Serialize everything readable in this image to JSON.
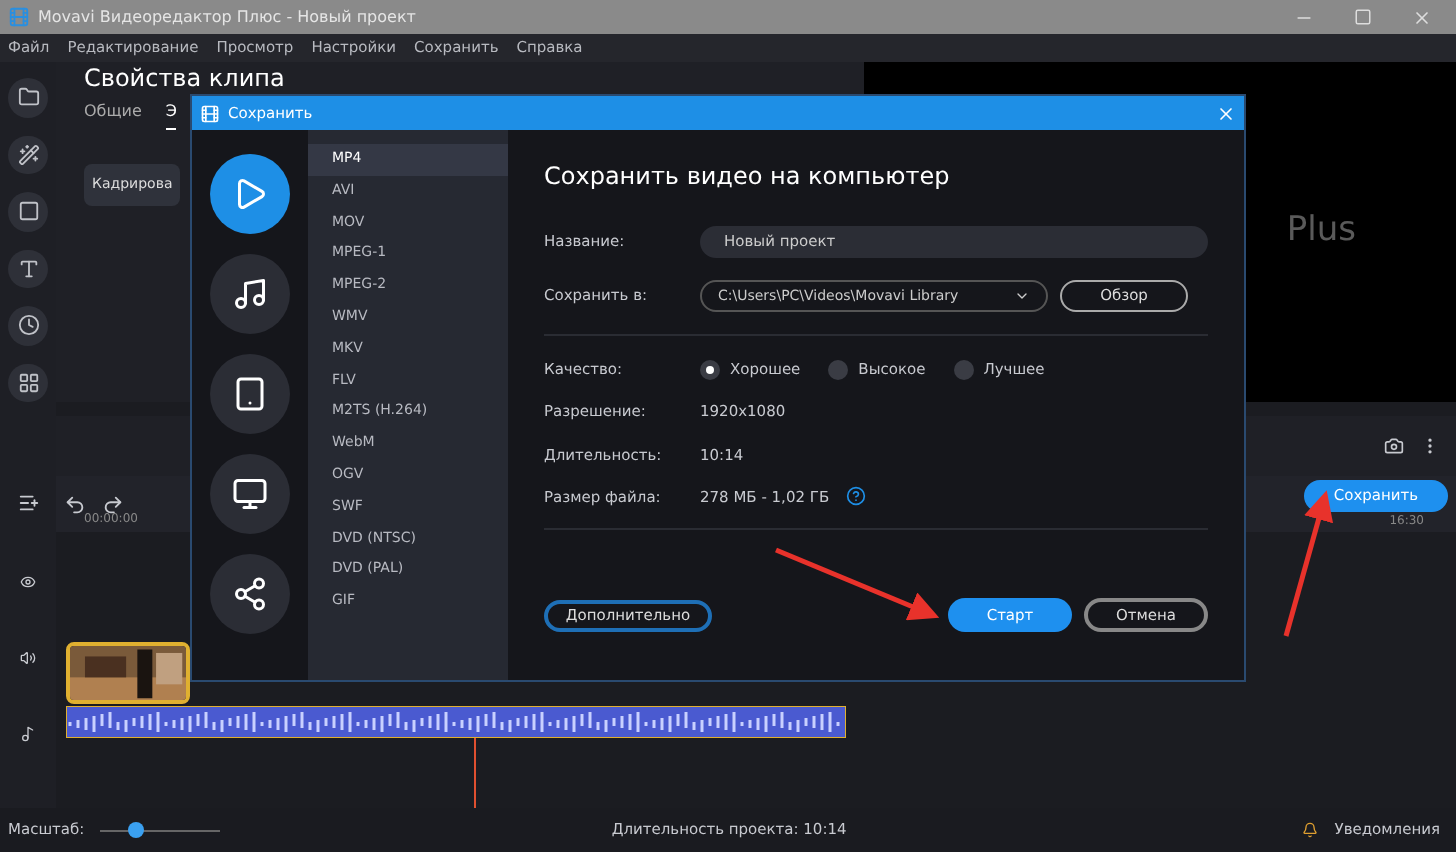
{
  "window": {
    "title": "Movavi Видеоредактор Плюс - Новый проект"
  },
  "menu": [
    "Файл",
    "Редактирование",
    "Просмотр",
    "Настройки",
    "Сохранить",
    "Справка"
  ],
  "clip_panel": {
    "title": "Свойства клипа",
    "tabs": [
      {
        "label": "Общие",
        "selected": false
      },
      {
        "label": "Э",
        "selected": true
      }
    ],
    "button": "Кадрирова"
  },
  "preview": {
    "text": "Plus"
  },
  "timeline": {
    "ruler": [
      "00:00:00",
      "16:30"
    ],
    "save_button": "Сохранить"
  },
  "status_bar": {
    "zoom_label": "Масштаб:",
    "zoom": {
      "level": 0.3
    },
    "duration": "Длительность проекта: 10:14",
    "notifications": "Уведомления"
  },
  "dialog": {
    "title": "Сохранить",
    "categories": [
      {
        "kind": "video",
        "selected": true
      },
      {
        "kind": "audio",
        "selected": false
      },
      {
        "kind": "devices",
        "selected": false
      },
      {
        "kind": "tv",
        "selected": false
      },
      {
        "kind": "share",
        "selected": false
      }
    ],
    "formats": [
      {
        "label": "MP4",
        "selected": true
      },
      {
        "label": "AVI",
        "selected": false
      },
      {
        "label": "MOV",
        "selected": false
      },
      {
        "label": "MPEG-1",
        "selected": false
      },
      {
        "label": "MPEG-2",
        "selected": false
      },
      {
        "label": "WMV",
        "selected": false
      },
      {
        "label": "MKV",
        "selected": false
      },
      {
        "label": "FLV",
        "selected": false
      },
      {
        "label": "M2TS (H.264)",
        "selected": false
      },
      {
        "label": "WebM",
        "selected": false
      },
      {
        "label": "OGV",
        "selected": false
      },
      {
        "label": "SWF",
        "selected": false
      },
      {
        "label": "DVD (NTSC)",
        "selected": false
      },
      {
        "label": "DVD (PAL)",
        "selected": false
      },
      {
        "label": "GIF",
        "selected": false
      }
    ],
    "heading": "Сохранить видео на компьютер",
    "name_label": "Название:",
    "name_value": "Новый проект",
    "folder_label": "Сохранить в:",
    "folder_value": "C:\\Users\\PC\\Videos\\Movavi Library",
    "browse_button": "Обзор",
    "quality_label": "Качество:",
    "quality": [
      {
        "label": "Хорошее",
        "selected": true
      },
      {
        "label": "Высокое",
        "selected": false
      },
      {
        "label": "Лучшее",
        "selected": false
      }
    ],
    "info": [
      {
        "label": "Разрешение:",
        "value": "1920x1080"
      },
      {
        "label": "Длительность:",
        "value": "10:14"
      },
      {
        "label": "Размер файла:",
        "value": "278 МБ - 1,02 ГБ",
        "help": true
      }
    ],
    "advanced_button": "Дополнительно",
    "start_button": "Старт",
    "cancel_button": "Отмена"
  }
}
